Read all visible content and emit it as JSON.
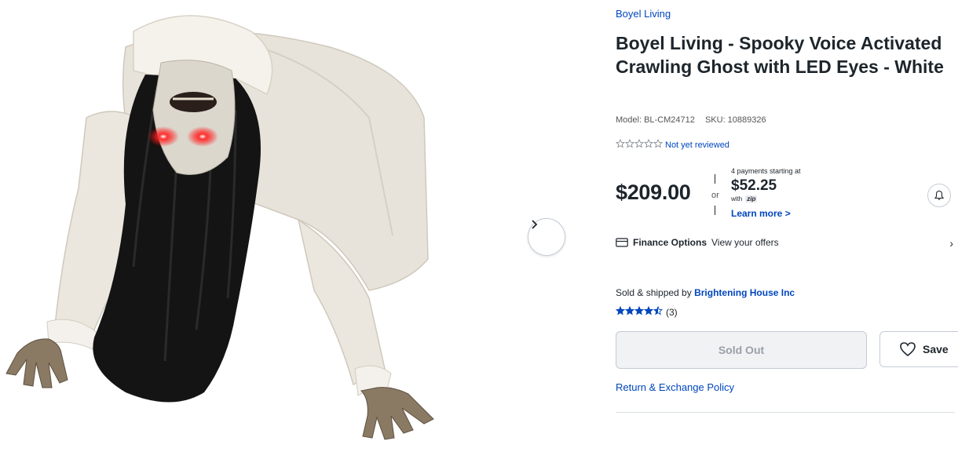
{
  "gallery": {
    "image_alt": "Crawling ghost with long black hair, white dress and glowing red LED eyes",
    "next_icon": "chevron-right-icon"
  },
  "product": {
    "brand": "Boyel Living",
    "title": "Boyel Living - Spooky Voice Activated Crawling Ghost with LED Eyes - White",
    "model": "Model: BL-CM24712",
    "sku": "SKU: 10889326",
    "review_text": "Not yet reviewed",
    "rating_value": 0,
    "rating_max": 5
  },
  "pricing": {
    "price": "$209.00",
    "or_text": "or",
    "installments_intro": "4 payments starting at",
    "installment_amount": "$52.25",
    "with_text": "with",
    "zip_logo": "zip",
    "learn_more": "Learn more >"
  },
  "finance": {
    "label": "Finance Options",
    "offers": "View your offers",
    "chevron": "›"
  },
  "seller": {
    "prefix": "Sold & shipped by",
    "name": "Brightening House Inc",
    "rating_value": 4.5,
    "rating_max": 5,
    "rating_count": "(3)"
  },
  "actions": {
    "sold_out_label": "Sold Out",
    "save_label": "Save"
  },
  "links": {
    "return_policy": "Return & Exchange Policy"
  },
  "colors": {
    "link_blue": "#0046be",
    "text_dark": "#1d252c",
    "eye_red": "#ff2a2a"
  }
}
